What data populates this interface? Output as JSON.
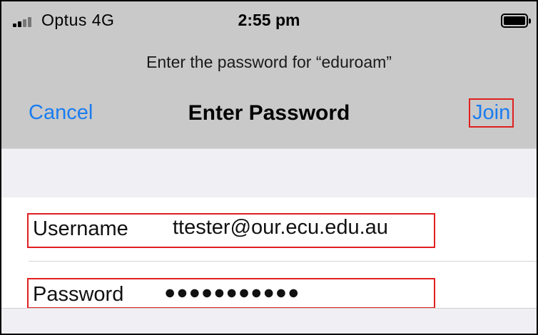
{
  "status_bar": {
    "carrier": "Optus  4G",
    "time": "2:55 pm",
    "signal_icon": "signal-bars-icon",
    "battery_icon": "battery-full-icon"
  },
  "dialog": {
    "prompt": "Enter the password for “eduroam”",
    "title": "Enter Password",
    "cancel_label": "Cancel",
    "join_label": "Join"
  },
  "form": {
    "username": {
      "label": "Username",
      "value": "ttester@our.ecu.edu.au"
    },
    "password": {
      "label": "Password",
      "value": "●●●●●●●●●●●"
    }
  },
  "colors": {
    "accent": "#1a7cf0",
    "highlight": "#e02020",
    "header_bg": "#c9c9c9",
    "grouped_bg": "#efeff4"
  }
}
